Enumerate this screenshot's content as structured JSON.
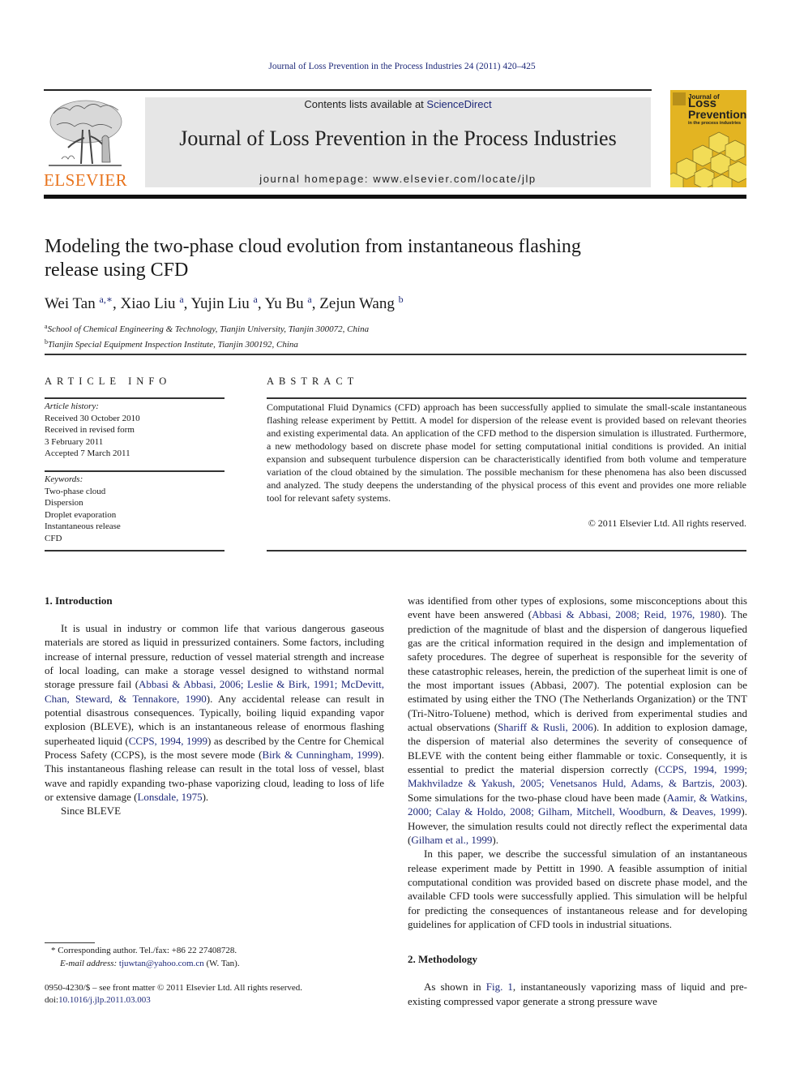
{
  "header": {
    "citation": "Journal of Loss Prevention in the Process Industries 24 (2011) 420–425",
    "contents_prefix": "Contents lists available at ",
    "contents_link": "ScienceDirect",
    "journal_title": "Journal of Loss Prevention in the Process Industries",
    "homepage": "journal homepage: www.elsevier.com/locate/jlp",
    "publisher_logo": "ELSEVIER",
    "cover": {
      "line1": "Journal of",
      "line2": "Loss",
      "line3": "Prevention",
      "line4": "in the process industries"
    },
    "colors": {
      "link": "#1f2a7a",
      "elsevier_orange": "#e8731c",
      "cover_yellow": "#e3b422",
      "masthead_gray": "#e6e6e6"
    }
  },
  "article": {
    "title": "Modeling the two-phase cloud evolution from instantaneous flashing release using CFD",
    "authors": [
      {
        "name": "Wei Tan",
        "sup": "a,∗"
      },
      {
        "name": "Xiao Liu",
        "sup": "a"
      },
      {
        "name": "Yujin Liu",
        "sup": "a"
      },
      {
        "name": "Yu Bu",
        "sup": "a"
      },
      {
        "name": "Zejun Wang",
        "sup": "b"
      }
    ],
    "affiliations": [
      {
        "mark": "a",
        "text": "School of Chemical Engineering & Technology, Tianjin University, Tianjin 300072, China"
      },
      {
        "mark": "b",
        "text": "Tianjin Special Equipment Inspection Institute, Tianjin 300192, China"
      }
    ]
  },
  "article_info": {
    "label": "ARTICLE INFO",
    "history_head": "Article history:",
    "history": [
      "Received 30 October 2010",
      "Received in revised form",
      "3 February 2011",
      "Accepted 7 March 2011"
    ],
    "keywords_head": "Keywords:",
    "keywords": [
      "Two-phase cloud",
      "Dispersion",
      "Droplet evaporation",
      "Instantaneous release",
      "CFD"
    ]
  },
  "abstract": {
    "label": "ABSTRACT",
    "text": "Computational Fluid Dynamics (CFD) approach has been successfully applied to simulate the small-scale instantaneous flashing release experiment by Pettitt. A model for dispersion of the release event is provided based on relevant theories and existing experimental data. An application of the CFD method to the dispersion simulation is illustrated. Furthermore, a new methodology based on discrete phase model for setting computational initial conditions is provided. An initial expansion and subsequent turbulence dispersion can be characteristically identified from both volume and temperature variation of the cloud obtained by the simulation. The possible mechanism for these phenomena has also been discussed and analyzed. The study deepens the understanding of the physical process of this event and provides one more reliable tool for relevant safety systems.",
    "copyright": "© 2011 Elsevier Ltd. All rights reserved."
  },
  "body": {
    "sec1_heading": "1.  Introduction",
    "p1": [
      {
        "t": "It is usual in industry or common life that various dangerous gaseous materials are stored as liquid in pressurized containers. Some factors, including increase of internal pressure, reduction of vessel material strength and increase of local loading, can make a storage vessel designed to withstand normal storage pressure fail ("
      },
      {
        "l": "Abbasi & Abbasi, 2006; Leslie & Birk, 1991; McDevitt, Chan, Steward, & Tennakore, 1990"
      },
      {
        "t": "). Any accidental release can result in potential disastrous consequences. Typically, boiling liquid expanding vapor explosion (BLEVE), which is an instantaneous release of enormous flashing superheated liquid ("
      },
      {
        "l": "CCPS, 1994, 1999"
      },
      {
        "t": ") as described by the Centre for Chemical Process Safety (CCPS), is the most severe mode ("
      },
      {
        "l": "Birk & Cunningham, 1999"
      },
      {
        "t": "). This instantaneous flashing release can result in the total loss of vessel, blast wave and rapidly expanding two-phase vaporizing cloud, leading to loss of life or extensive damage ("
      },
      {
        "l": "Lonsdale, 1975"
      },
      {
        "t": ")."
      }
    ],
    "p2": [
      {
        "t": "Since BLEVE was identified from other types of explosions, some misconceptions about this event have been answered ("
      },
      {
        "l": "Abbasi & Abbasi, 2008; Reid, 1976, 1980"
      },
      {
        "t": "). The prediction of the magnitude of blast and the dispersion of dangerous liquefied gas are the critical information required in the design and implementation of safety procedures. The degree of superheat is responsible for the severity of these catastrophic releases, herein, the prediction of the superheat limit is one of the most important issues (Abbasi, 2007). The potential explosion can be estimated by using either the TNO (The Netherlands Organization) or the TNT (Tri-Nitro-Toluene) method, which is derived from experimental studies and actual observations ("
      },
      {
        "l": "Shariff & Rusli, 2006"
      },
      {
        "t": "). In addition to explosion damage, the dispersion of material also determines the severity of consequence of BLEVE with the content being either flammable or toxic. Consequently, it is essential to predict the material dispersion correctly ("
      },
      {
        "l": "CCPS, 1994, 1999; Makhviladze & Yakush, 2005; Venetsanos Huld, Adams, & Bartzis, 2003"
      },
      {
        "t": "). Some simulations for the two-phase cloud have been made ("
      },
      {
        "l": "Aamir, & Watkins, 2000; Calay & Holdo, 2008; Gilham, Mitchell, Woodburn, & Deaves, 1999"
      },
      {
        "t": "). However, the simulation results could not directly reflect the experimental data ("
      },
      {
        "l": "Gilham et al., 1999"
      },
      {
        "t": ")."
      }
    ],
    "p3": "In this paper, we describe the successful simulation of an instantaneous release experiment made by Pettitt in 1990. A feasible assumption of initial computational condition was provided based on discrete phase model, and the available CFD tools were successfully applied. This simulation will be helpful for predicting the consequences of instantaneous release and for developing guidelines for application of CFD tools in industrial situations.",
    "sec2_heading": "2.  Methodology",
    "p4": [
      {
        "t": "As shown in "
      },
      {
        "l": "Fig. 1"
      },
      {
        "t": ", instantaneously vaporizing mass of liquid and pre-existing compressed vapor generate a strong pressure wave"
      }
    ]
  },
  "footnotes": {
    "corresponding": "* Corresponding author. Tel./fax: +86 22 27408728.",
    "email_label": "E-mail address: ",
    "email": "tjuwtan@yahoo.com.cn",
    "email_suffix": " (W. Tan).",
    "front_matter": "0950-4230/$ – see front matter © 2011 Elsevier Ltd. All rights reserved.",
    "doi_label": "doi:",
    "doi": "10.1016/j.jlp.2011.03.003"
  }
}
